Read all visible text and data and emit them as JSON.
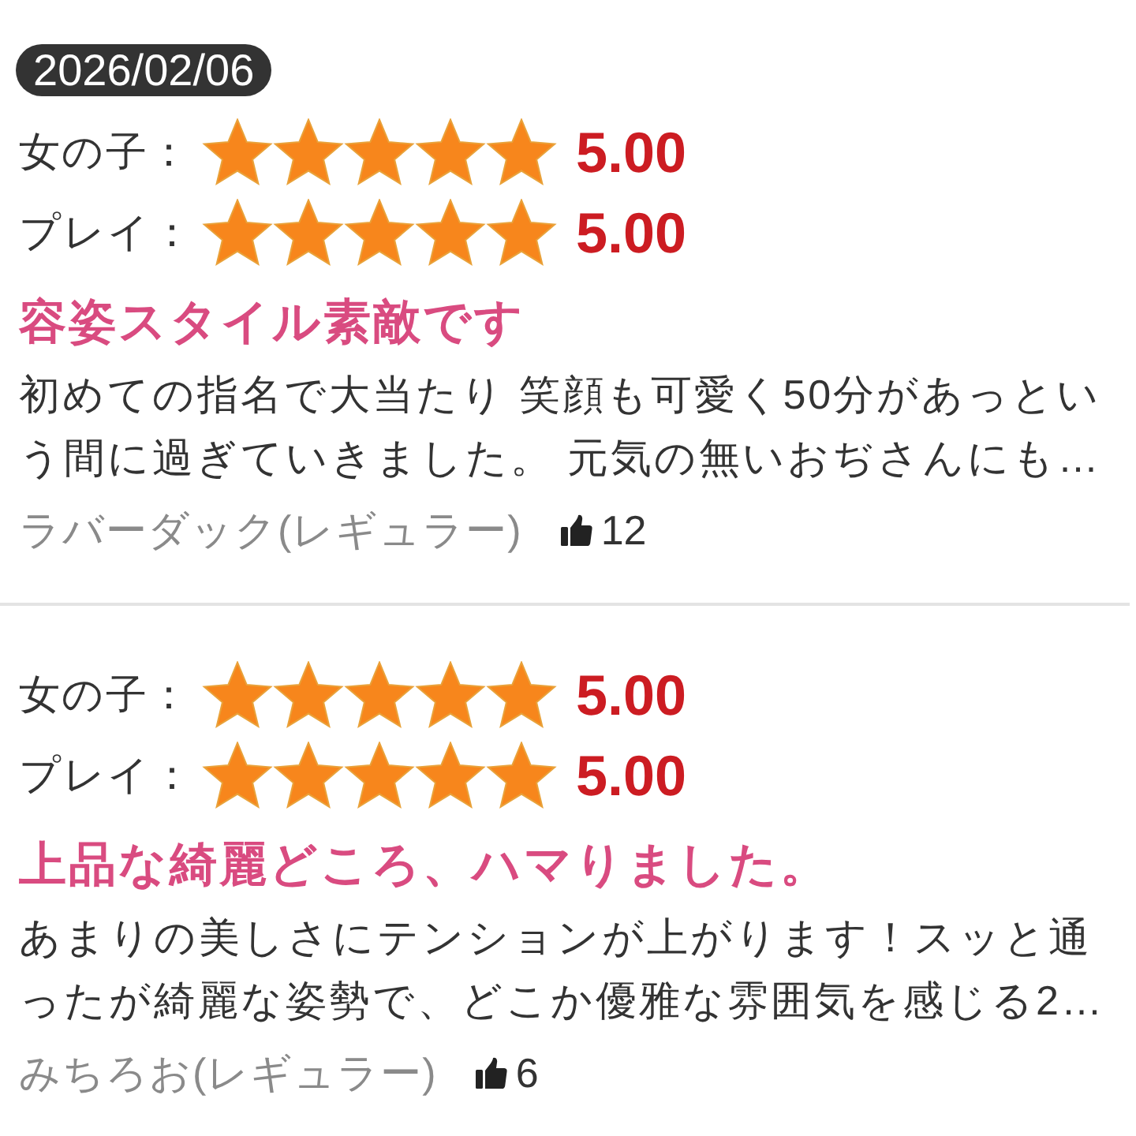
{
  "reviews": [
    {
      "date": "2026/02/06",
      "ratings": [
        {
          "label": "女の子：",
          "stars": 5,
          "score": "5.00"
        },
        {
          "label": "プレイ：",
          "stars": 5,
          "score": "5.00"
        }
      ],
      "title": "容姿スタイル素敵です",
      "body": "初めての指名で大当たり 笑顔も可愛く50分があっという間に過ぎていきました。 元気の無いおぢさんにも…",
      "author": "ラバーダック(レギュラー)",
      "likes": "12"
    },
    {
      "ratings": [
        {
          "label": "女の子：",
          "stars": 5,
          "score": "5.00"
        },
        {
          "label": "プレイ：",
          "stars": 5,
          "score": "5.00"
        }
      ],
      "title": "上品な綺麗どころ、ハマりました。",
      "body": "あまりの美しさにテンションが上がります！スッと通ったが綺麗な姿勢で、どこか優雅な雰囲気を感じる2…",
      "author": "みちろお(レギュラー)",
      "likes": "6"
    }
  ]
}
